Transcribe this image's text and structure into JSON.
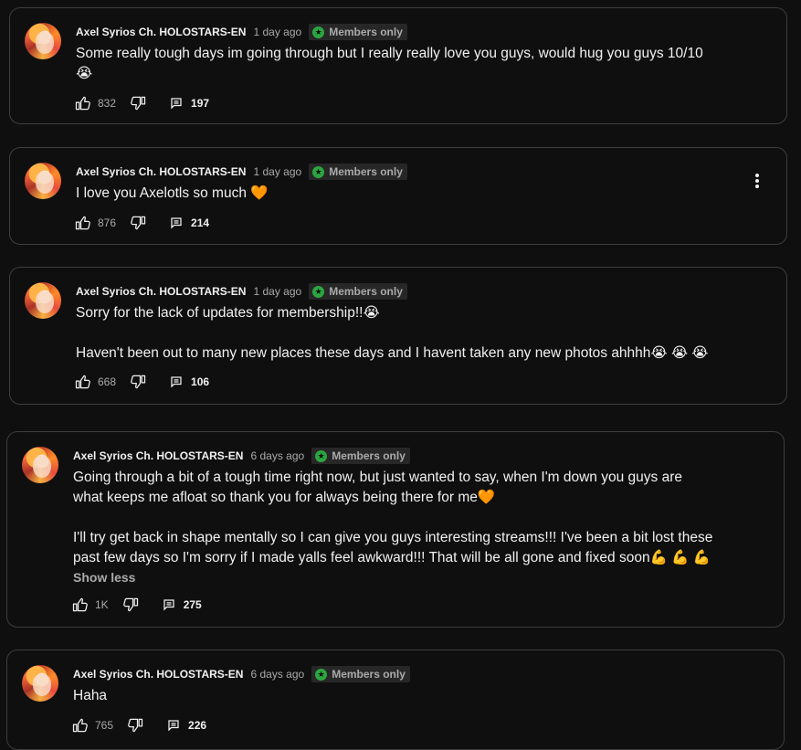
{
  "posts": [
    {
      "author": "Axel Syrios Ch. HOLOSTARS-EN",
      "time": "1 day ago",
      "badge": "Members only",
      "text": "Some really tough days im going through but I really really love you guys, would hug you guys 10/10\n😭",
      "likes": "832",
      "replies": "197"
    },
    {
      "author": "Axel Syrios Ch. HOLOSTARS-EN",
      "time": "1 day ago",
      "badge": "Members only",
      "text": "I love you Axelotls so much 🧡",
      "likes": "876",
      "replies": "214"
    },
    {
      "author": "Axel Syrios Ch. HOLOSTARS-EN",
      "time": "1 day ago",
      "badge": "Members only",
      "text": "Sorry for the lack of updates for membership!!😭\n\nHaven't been out to many new places these days and I havent taken any new photos ahhhh😭 😭 😭",
      "likes": "668",
      "replies": "106"
    },
    {
      "author": "Axel Syrios Ch. HOLOSTARS-EN",
      "time": "6 days ago",
      "badge": "Members only",
      "text": "Going through a bit of a tough time right now, but just wanted to say, when I'm down you guys are\nwhat keeps me afloat so thank you for always being there for me🧡\n\nI'll try get back in shape mentally so I can give you guys interesting streams!!! I've been a bit lost these\npast few days so I'm sorry if I made yalls feel awkward!!! That will be all gone and fixed soon💪 💪 💪",
      "show_less": "Show less",
      "likes": "1K",
      "replies": "275"
    },
    {
      "author": "Axel Syrios Ch. HOLOSTARS-EN",
      "time": "6 days ago",
      "badge": "Members only",
      "text": "Haha",
      "likes": "765",
      "replies": "226"
    }
  ],
  "icons": {
    "like": "thumb-up-icon",
    "dislike": "thumb-down-icon",
    "reply": "comment-icon",
    "badge": "membership-star-icon",
    "menu": "more-vert-icon"
  },
  "colors": {
    "background": "#0f0f0f",
    "border": "#3e3e3e",
    "badge_green": "#2ba640",
    "muted": "#aaaaaa"
  }
}
